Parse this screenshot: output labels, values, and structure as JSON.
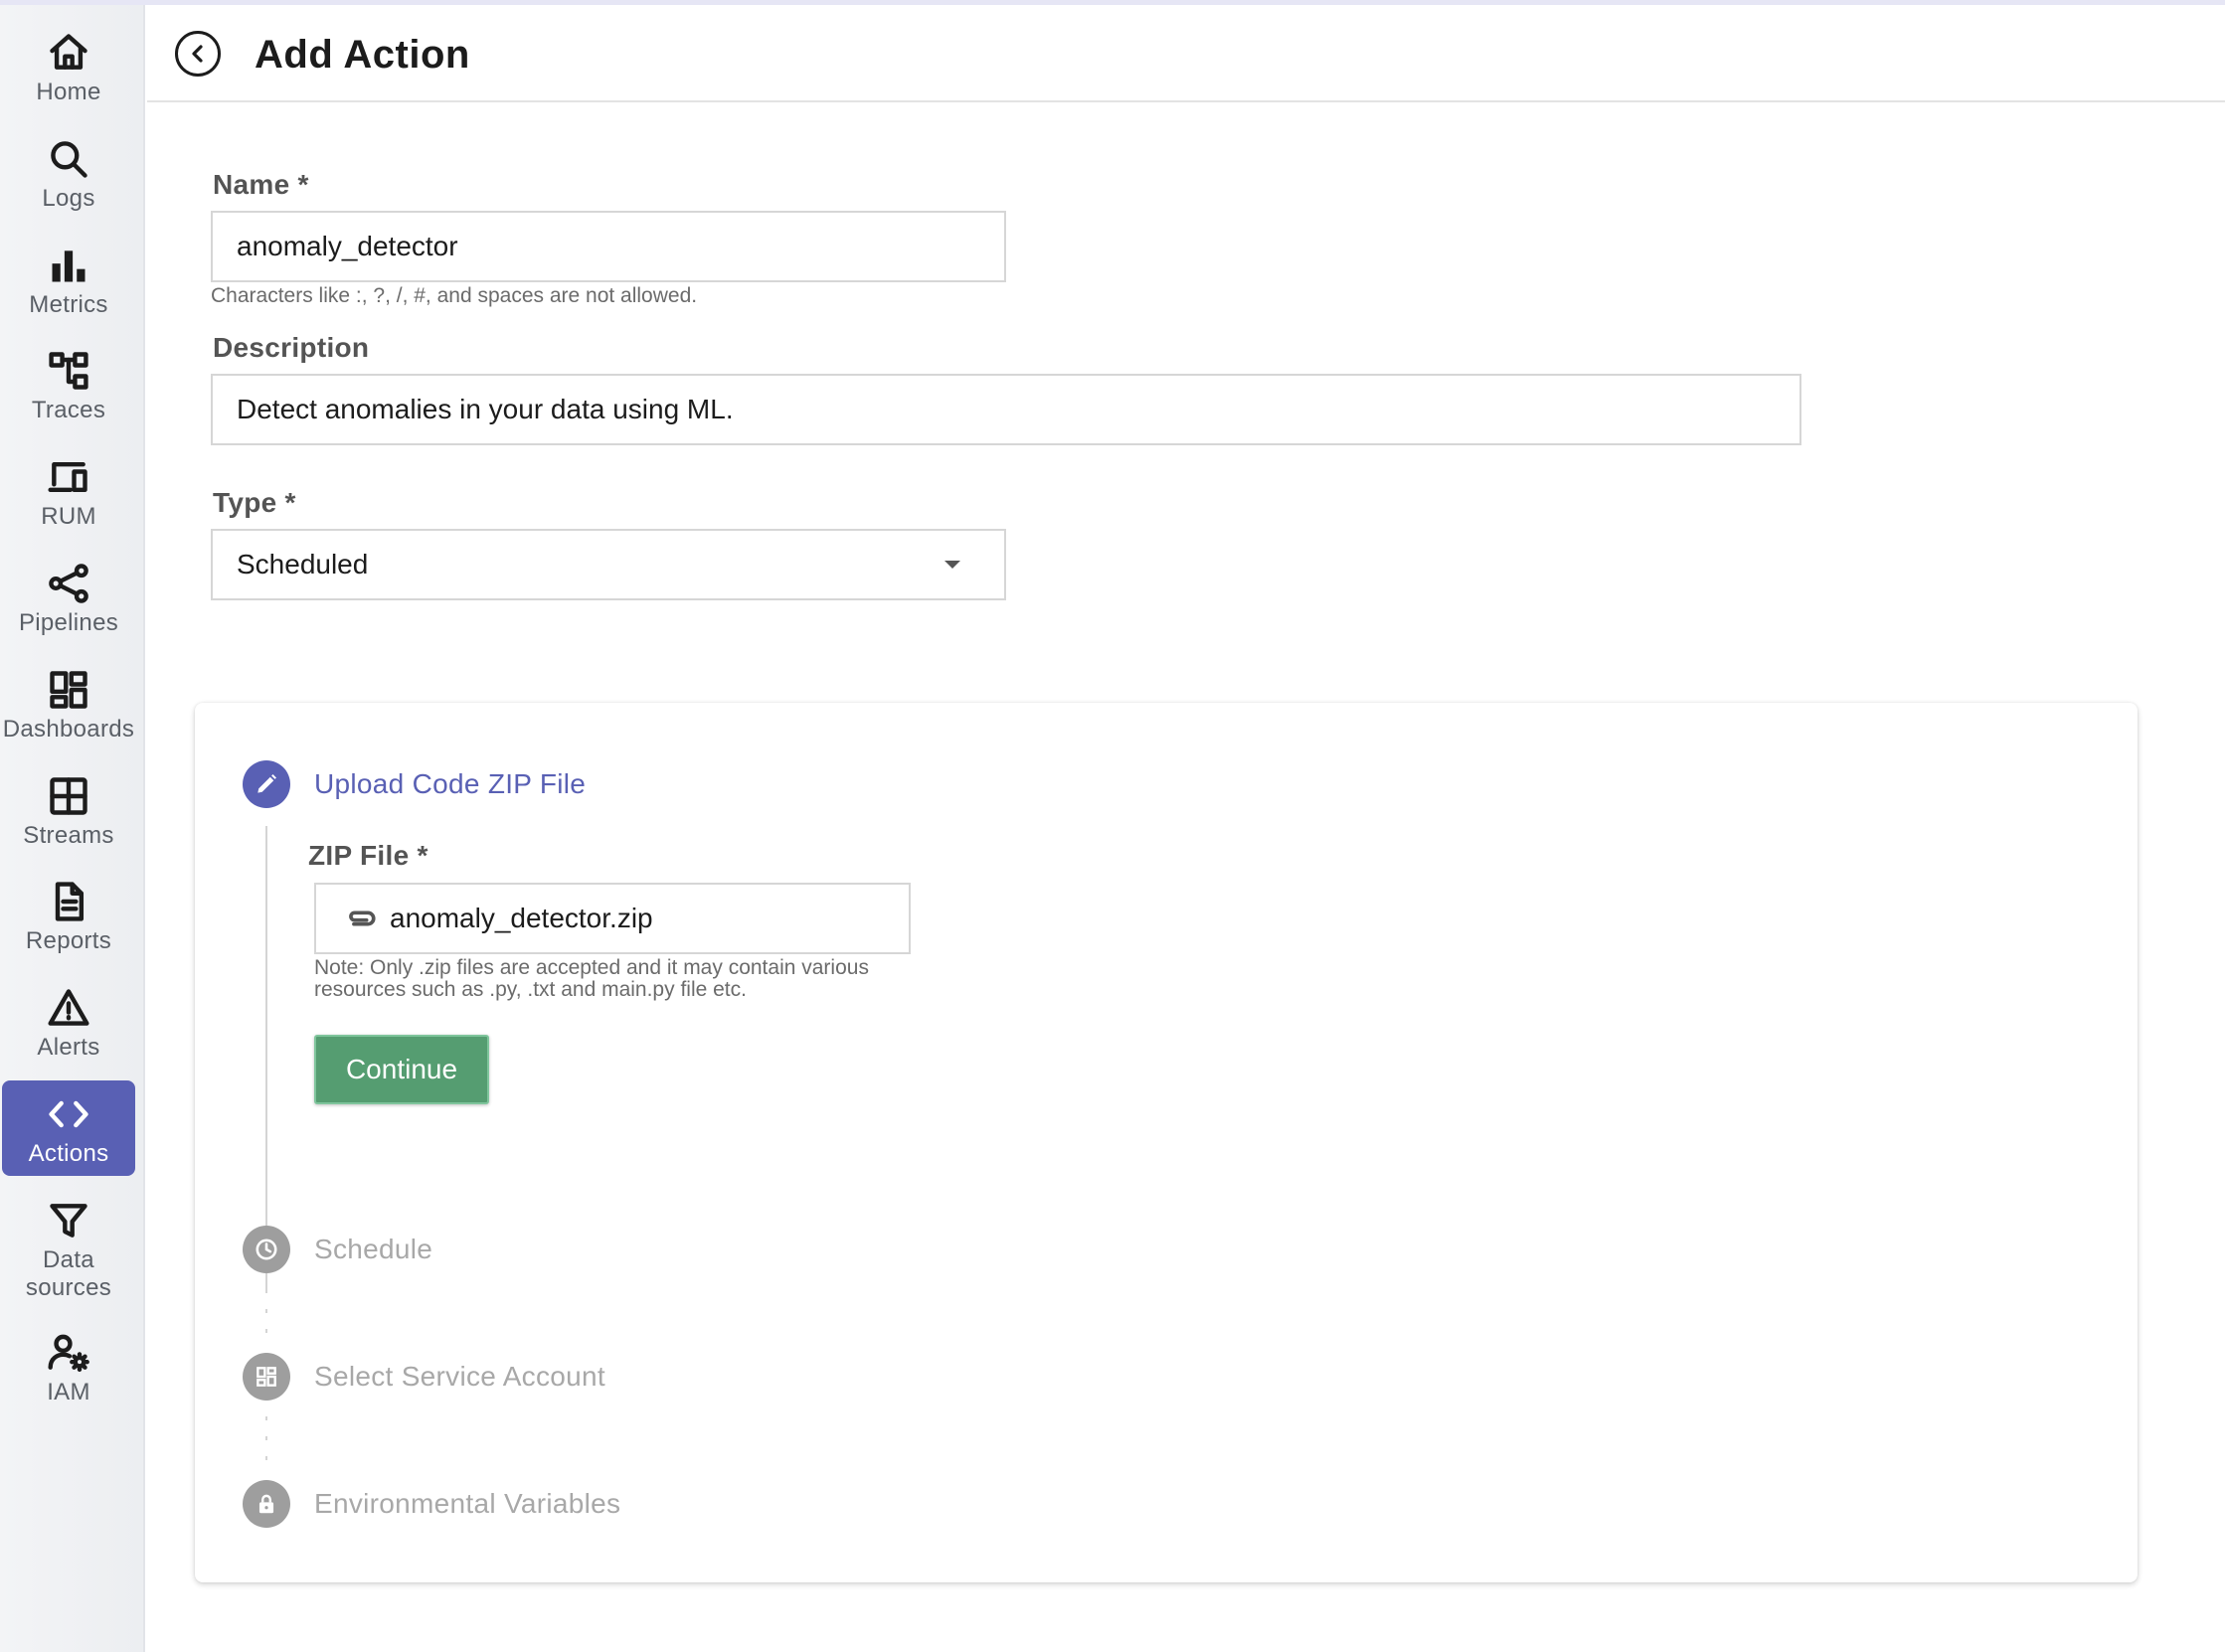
{
  "sidebar": {
    "items": [
      {
        "label": "Home",
        "icon": "home-icon"
      },
      {
        "label": "Logs",
        "icon": "search-icon"
      },
      {
        "label": "Metrics",
        "icon": "bar-chart-icon"
      },
      {
        "label": "Traces",
        "icon": "account-tree-icon"
      },
      {
        "label": "RUM",
        "icon": "devices-icon"
      },
      {
        "label": "Pipelines",
        "icon": "share-icon"
      },
      {
        "label": "Dashboards",
        "icon": "dashboard-icon"
      },
      {
        "label": "Streams",
        "icon": "grid-icon"
      },
      {
        "label": "Reports",
        "icon": "document-icon"
      },
      {
        "label": "Alerts",
        "icon": "warning-icon"
      },
      {
        "label": "Actions",
        "icon": "code-icon",
        "active": true
      },
      {
        "label": "Data sources",
        "label_line1": "Data",
        "label_line2": "sources",
        "icon": "filter-icon"
      },
      {
        "label": "IAM",
        "icon": "manage-accounts-icon"
      }
    ]
  },
  "header": {
    "title": "Add Action"
  },
  "form": {
    "name": {
      "label": "Name *",
      "value": "anomaly_detector",
      "hint": "Characters like :, ?, /, #, and spaces are not allowed."
    },
    "description": {
      "label": "Description",
      "value": "Detect anomalies in your data using ML."
    },
    "type": {
      "label": "Type *",
      "value": "Scheduled"
    }
  },
  "stepper": {
    "steps": [
      {
        "title": "Upload Code ZIP File",
        "state": "active",
        "icon": "pencil-icon"
      },
      {
        "title": "Schedule",
        "state": "inactive",
        "icon": "clock-icon"
      },
      {
        "title": "Select Service Account",
        "state": "inactive",
        "icon": "dashboard-icon"
      },
      {
        "title": "Environmental Variables",
        "state": "inactive",
        "icon": "lock-icon"
      }
    ],
    "zip": {
      "label": "ZIP File *",
      "filename": "anomaly_detector.zip",
      "note_line1": "Note: Only .zip files are accepted and it may contain various",
      "note_line2": "resources such as .py, .txt and main.py file etc."
    },
    "continue_label": "Continue"
  },
  "colors": {
    "primary": "#5960b4",
    "continue": "#559d71",
    "inactive": "#9e9e9e"
  }
}
